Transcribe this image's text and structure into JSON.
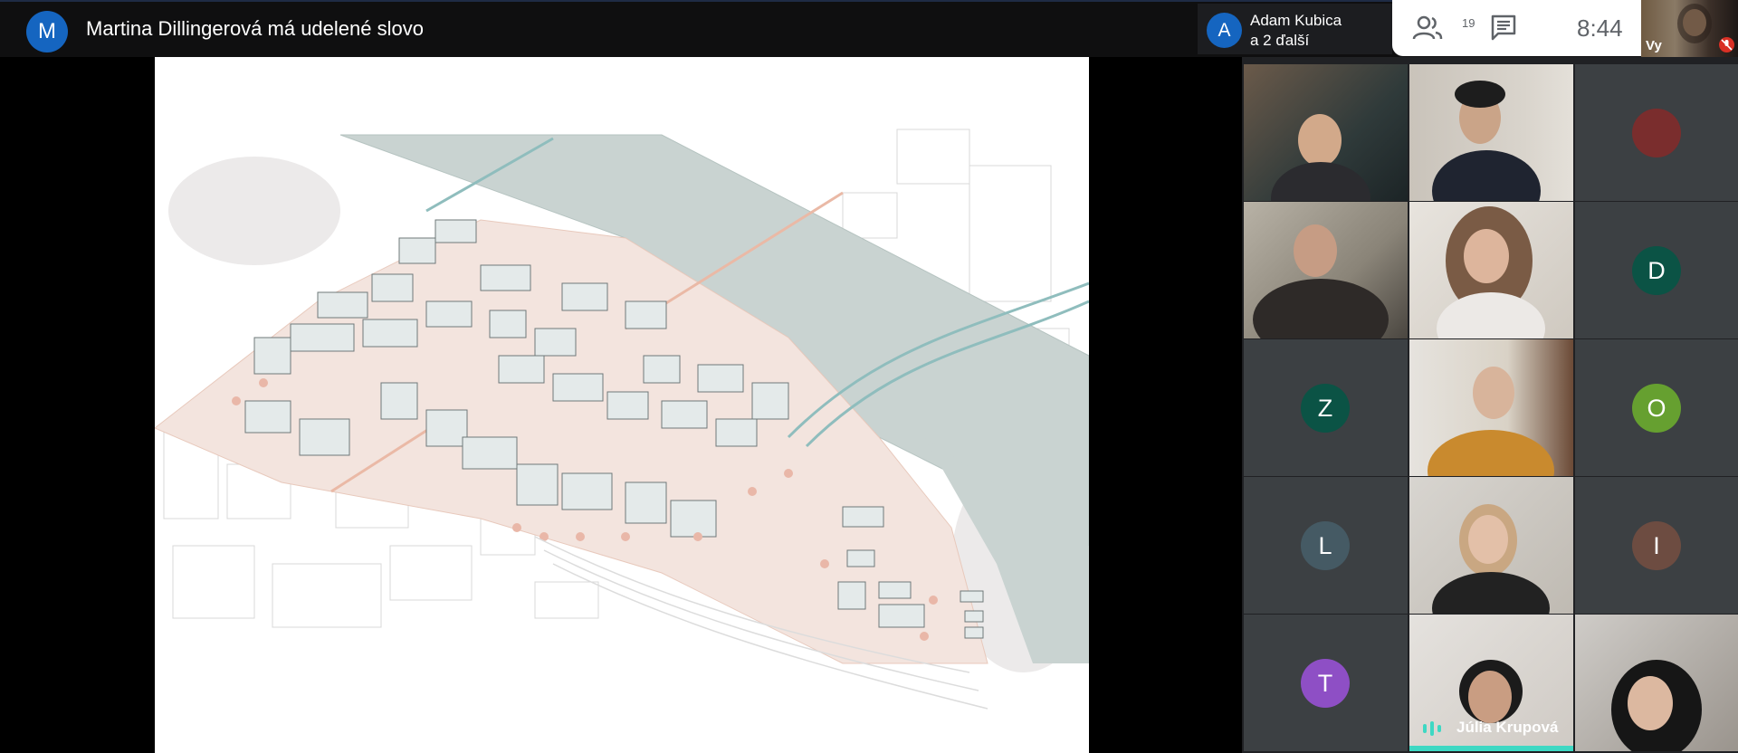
{
  "topbar": {
    "presenter_initial": "M",
    "presenter_title": "Martina Dillingerová má udelené slovo",
    "speaker_initial": "A",
    "speaker_name": "Adam Kubica",
    "speaker_more": "a 2 ďalší",
    "people_count": "19",
    "clock": "8:44",
    "self_label": "Vy",
    "icons": [
      "people-icon",
      "chat-icon",
      "mic-off-icon"
    ]
  },
  "grid": {
    "avatars": [
      {
        "initial": "D",
        "color": "#0b5345"
      },
      {
        "initial": "Z",
        "color": "#0b5345"
      },
      {
        "initial": "O",
        "color": "#66a030"
      },
      {
        "initial": "L",
        "color": "#455a64"
      },
      {
        "initial": "I",
        "color": "#6d4c41"
      },
      {
        "initial": "T",
        "color": "#8e4fc5"
      }
    ],
    "active_speaker": "Júlia Krupová"
  },
  "colors": {
    "accent": "#1565c0",
    "speaking": "#3ed8c3",
    "tile_bg": "#202124"
  }
}
